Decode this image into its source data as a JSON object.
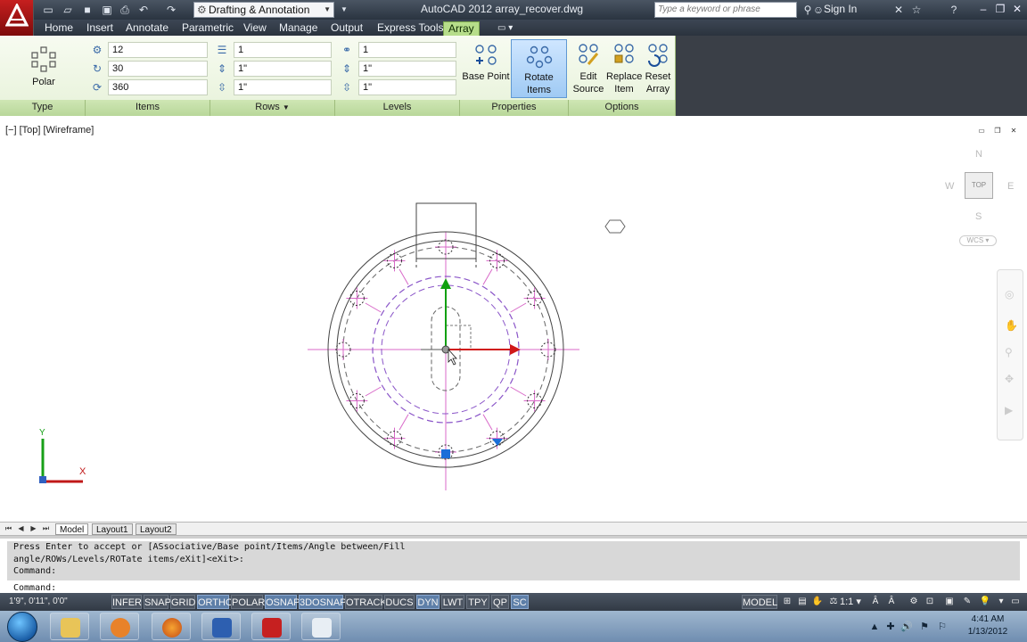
{
  "app": {
    "title": "AutoCAD 2012   array_recover.dwg",
    "workspace": "Drafting & Annotation",
    "search_placeholder": "Type a keyword or phrase",
    "sign_in": "Sign In"
  },
  "tabs": [
    "Home",
    "Insert",
    "Annotate",
    "Parametric",
    "View",
    "Manage",
    "Output",
    "Express Tools",
    "Array"
  ],
  "active_tab": "Array",
  "ribbon": {
    "type": {
      "button": "Polar",
      "label": "Type"
    },
    "items": {
      "count": "12",
      "fill": "30",
      "angle": "360",
      "label": "Items"
    },
    "rows": {
      "count": "1",
      "between": "1\"",
      "total": "1\"",
      "label": "Rows"
    },
    "levels": {
      "count": "1",
      "between": "1\"",
      "total": "1\"",
      "label": "Levels"
    },
    "properties": {
      "base_point": "Base Point",
      "rotate_items": "Rotate Items",
      "label": "Properties"
    },
    "options": {
      "edit_source": [
        "Edit",
        "Source"
      ],
      "replace_item": [
        "Replace",
        "Item"
      ],
      "reset_array": [
        "Reset",
        "Array"
      ],
      "label": "Options"
    }
  },
  "viewport": {
    "label": "[−] [Top] [Wireframe]",
    "viewcube": {
      "n": "N",
      "s": "S",
      "e": "E",
      "w": "W",
      "face": "TOP",
      "wcs": "WCS"
    },
    "ucs": {
      "x": "X",
      "y": "Y"
    }
  },
  "layout_tabs": [
    "Model",
    "Layout1",
    "Layout2"
  ],
  "command": {
    "history": [
      "Press Enter to accept or [ASsociative/Base point/Items/Angle between/Fill",
      "angle/ROWs/Levels/ROTate items/eXit]<eXit>:",
      "Command:"
    ],
    "prompt": "Command:"
  },
  "status": {
    "coords": "1'9\", 0'11\", 0'0\"",
    "toggles": [
      "INFER",
      "SNAP",
      "GRID",
      "ORTHO",
      "POLAR",
      "OSNAP",
      "3DOSNAP",
      "OTRACK",
      "DUCS",
      "DYN",
      "LWT",
      "TPY",
      "QP",
      "SC"
    ],
    "on": [
      "ORTHO",
      "OSNAP",
      "3DOSNAP",
      "DYN",
      "SC"
    ],
    "model": "MODEL",
    "scale": "1:1"
  },
  "taskbar": {
    "time": "4:41 AM",
    "date": "1/13/2012"
  },
  "colors": {
    "ribbon_green": "#e7f2d9",
    "accent_red": "#c61f1f",
    "magenta": "#d060c8",
    "purple_dash": "#8a55c8",
    "axis_red": "#d01818",
    "axis_green": "#10a010"
  }
}
